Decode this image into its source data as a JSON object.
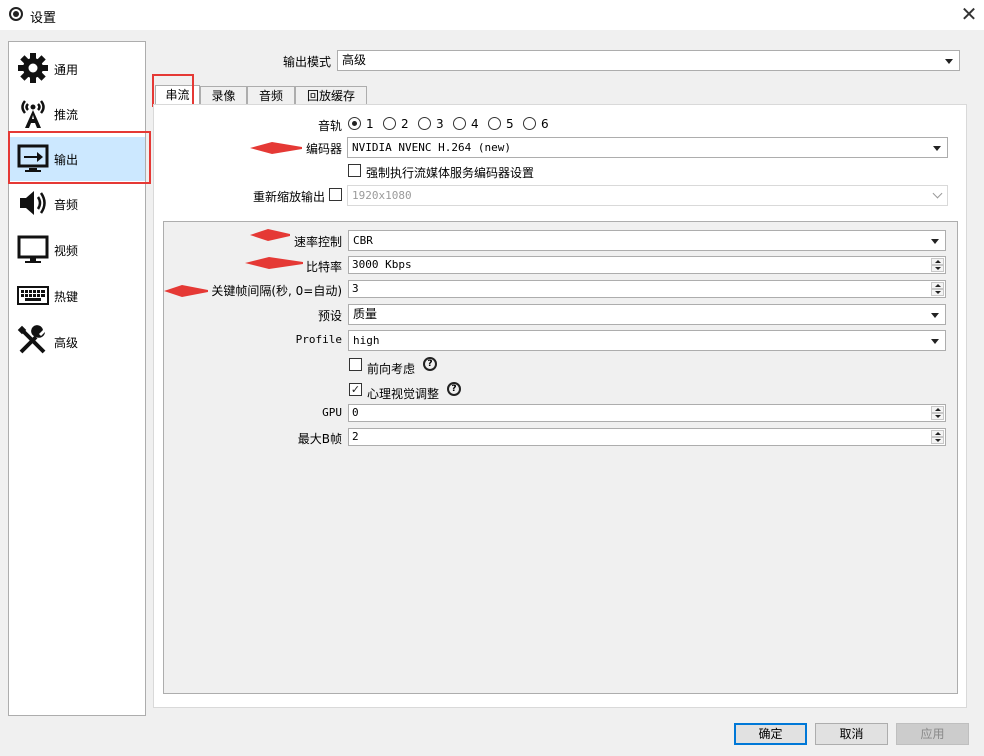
{
  "window": {
    "title": "设置"
  },
  "sidebar": {
    "items": [
      {
        "label": "通用",
        "icon": "gear-icon"
      },
      {
        "label": "推流",
        "icon": "antenna-icon"
      },
      {
        "label": "输出",
        "icon": "output-monitor-icon",
        "active": true
      },
      {
        "label": "音频",
        "icon": "speaker-icon"
      },
      {
        "label": "视频",
        "icon": "monitor-icon"
      },
      {
        "label": "热键",
        "icon": "keyboard-icon"
      },
      {
        "label": "高级",
        "icon": "tools-icon"
      }
    ]
  },
  "output_mode": {
    "label": "输出模式",
    "value": "高级"
  },
  "tabs": [
    {
      "label": "串流",
      "active": true
    },
    {
      "label": "录像"
    },
    {
      "label": "音频"
    },
    {
      "label": "回放缓存"
    }
  ],
  "streaming": {
    "audio_track": {
      "label": "音轨",
      "options": [
        "1",
        "2",
        "3",
        "4",
        "5",
        "6"
      ],
      "selected": "1"
    },
    "encoder": {
      "label": "编码器",
      "value": "NVIDIA NVENC H.264 (new)"
    },
    "enforce_settings": {
      "label": "强制执行流媒体服务编码器设置",
      "checked": false
    },
    "rescale": {
      "label": "重新缩放输出",
      "checked": false,
      "value": "1920x1080"
    }
  },
  "encoder_settings": {
    "rate_control": {
      "label": "速率控制",
      "value": "CBR"
    },
    "bitrate": {
      "label": "比特率",
      "value": "3000 Kbps"
    },
    "keyframe": {
      "label": "关键帧间隔(秒, 0=自动)",
      "value": "3"
    },
    "preset": {
      "label": "预设",
      "value": "质量"
    },
    "profile": {
      "label": "Profile",
      "value": "high"
    },
    "lookahead": {
      "label": "前向考虑",
      "checked": false
    },
    "psycho_visual": {
      "label": "心理视觉调整",
      "checked": true
    },
    "gpu": {
      "label": "GPU",
      "value": "0"
    },
    "max_bframes": {
      "label": "最大B帧",
      "value": "2"
    }
  },
  "footer": {
    "ok": "确定",
    "cancel": "取消",
    "apply": "应用"
  },
  "colors": {
    "accent": "#0078d7",
    "highlight": "#e53935",
    "selected": "#cce8ff"
  }
}
